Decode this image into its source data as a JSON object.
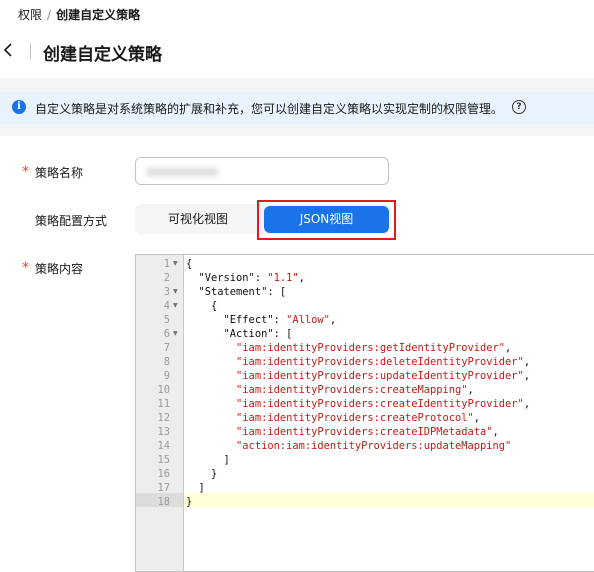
{
  "breadcrumb": {
    "parent": "权限",
    "separator": "/",
    "current": "创建自定义策略"
  },
  "header": {
    "title": "创建自定义策略"
  },
  "banner": {
    "text": "自定义策略是对系统策略的扩展和补充，您可以创建自定义策略以实现定制的权限管理。"
  },
  "form": {
    "name_label": "策略名称",
    "mode_label": "策略配置方式",
    "content_label": "策略内容",
    "required_mark": "*",
    "mode_options": {
      "visual": "可视化视图",
      "json": "JSON视图"
    },
    "selected_mode": "JSON视图"
  },
  "editor": {
    "active_line": 18,
    "lines": [
      {
        "n": "1",
        "fold": true,
        "text": "{"
      },
      {
        "n": "2",
        "fold": false,
        "text": "  \"Version\": \"1.1\","
      },
      {
        "n": "3",
        "fold": true,
        "text": "  \"Statement\": ["
      },
      {
        "n": "4",
        "fold": true,
        "text": "    {"
      },
      {
        "n": "5",
        "fold": false,
        "text": "      \"Effect\": \"Allow\","
      },
      {
        "n": "6",
        "fold": true,
        "text": "      \"Action\": ["
      },
      {
        "n": "7",
        "fold": false,
        "text": "        \"iam:identityProviders:getIdentityProvider\","
      },
      {
        "n": "8",
        "fold": false,
        "text": "        \"iam:identityProviders:deleteIdentityProvider\","
      },
      {
        "n": "9",
        "fold": false,
        "text": "        \"iam:identityProviders:updateIdentityProvider\","
      },
      {
        "n": "10",
        "fold": false,
        "text": "        \"iam:identityProviders:createMapping\","
      },
      {
        "n": "11",
        "fold": false,
        "text": "        \"iam:identityProviders:createIdentityProvider\","
      },
      {
        "n": "12",
        "fold": false,
        "text": "        \"iam:identityProviders:createProtocol\","
      },
      {
        "n": "13",
        "fold": false,
        "text": "        \"iam:identityProviders:createIDPMetadata\","
      },
      {
        "n": "14",
        "fold": false,
        "text": "        \"action:iam:identityProviders:updateMapping\""
      },
      {
        "n": "15",
        "fold": false,
        "text": "      ]"
      },
      {
        "n": "16",
        "fold": false,
        "text": "    }"
      },
      {
        "n": "17",
        "fold": false,
        "text": "  ]"
      },
      {
        "n": "18",
        "fold": false,
        "text": "}"
      }
    ]
  },
  "colors": {
    "primary": "#1a73e8",
    "required": "#e5472b",
    "highlight": "#e31b1b",
    "string": "#c41a16"
  },
  "icons": {
    "back": "chevron-left-icon",
    "info": "info-icon",
    "help": "help-icon",
    "fold": "fold-triangle-icon"
  }
}
